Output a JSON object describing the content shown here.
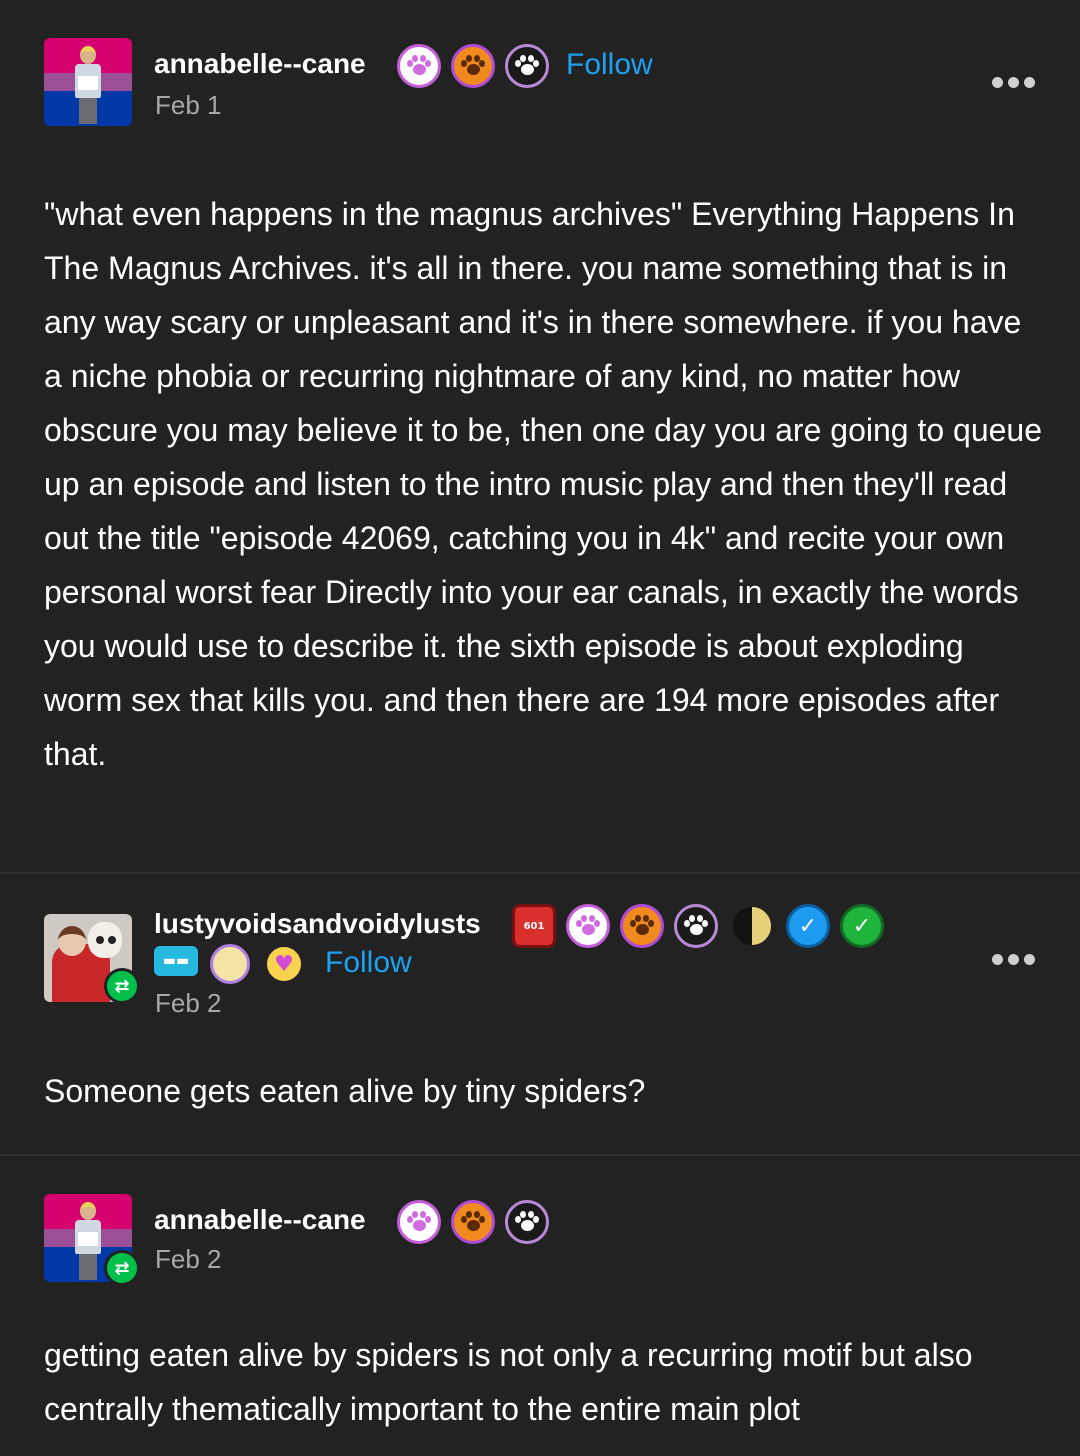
{
  "posts": [
    {
      "username": "annabelle--cane",
      "follow_label": "Follow",
      "date": "Feb 1",
      "body": "\"what even happens in the magnus archives\" Everything Happens In The Magnus Archives. it's all in there. you name something that is in any way scary or unpleasant and it's in there somewhere. if you have a niche phobia or recurring nightmare of any kind, no matter how obscure you may believe it to be, then one day you are going to queue up an episode and listen to the intro music play and then they'll read out the title \"episode 42069, catching you in 4k\" and recite your own personal worst fear Directly into your ear canals, in exactly the words you would use to describe it. the sixth episode is about exploding worm sex that kills you. and then there are 194 more episodes after that.",
      "badges": [
        "paw-pink-badge",
        "paw-orange-badge",
        "paw-black-badge"
      ]
    },
    {
      "username": "lustyvoidsandvoidylusts",
      "follow_label": "Follow",
      "date": "Feb 2",
      "body": "Someone gets eaten alive by tiny spiders?",
      "d20_label": "601",
      "teeth_label": "▬▬",
      "badges": [
        "d20-badge",
        "paw-pink-badge",
        "paw-orange-badge",
        "paw-black-badge",
        "moon-badge",
        "blue-check-badge",
        "green-check-badge",
        "teeth-badge",
        "unicorn-badge",
        "angel-heart-badge"
      ]
    },
    {
      "username": "annabelle--cane",
      "date": "Feb 2",
      "body": "getting eaten alive by spiders is not only a recurring motif but also centrally thematically important to the entire main plot",
      "badges": [
        "paw-pink-badge",
        "paw-orange-badge",
        "paw-black-badge"
      ]
    }
  ],
  "icons": {
    "reblog": "reblog-icon",
    "more": "more-options-icon"
  },
  "colors": {
    "background": "#222222",
    "follow": "#1da1f2",
    "date": "#a8a8a8",
    "reblog_green": "#00c04b"
  }
}
